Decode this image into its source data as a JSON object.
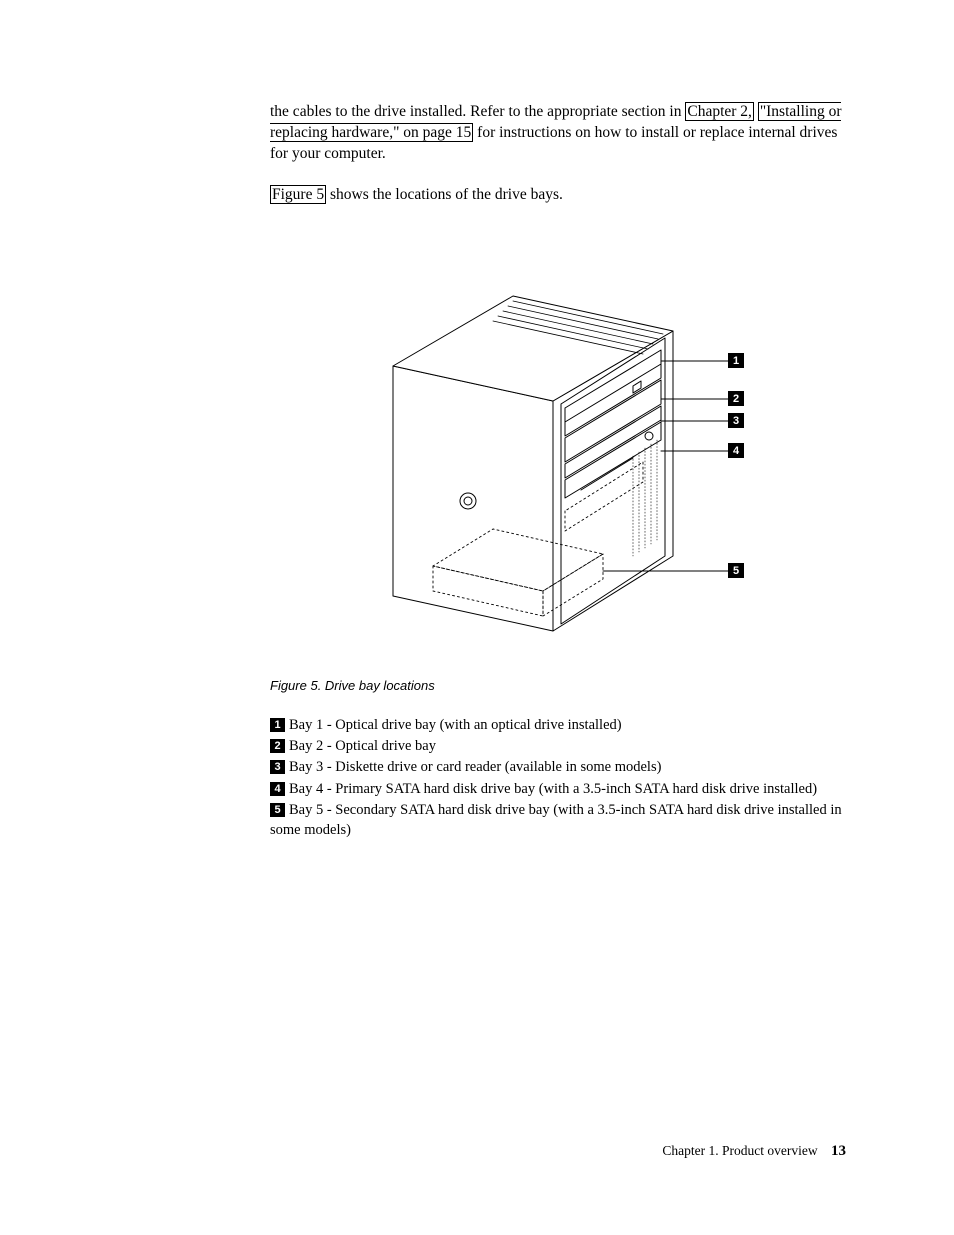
{
  "intro": {
    "t1a": "the cables to the drive installed. Refer to the appropriate section in ",
    "link1": "Chapter 2,",
    "link2": "\"Installing or replacing hardware,\" on page 15",
    "t1b": " for instructions on how to install or replace internal drives for your computer."
  },
  "intro2": {
    "link": "Figure 5",
    "rest": " shows the locations of the drive bays."
  },
  "figure": {
    "callouts": {
      "c1": "1",
      "c2": "2",
      "c3": "3",
      "c4": "4",
      "c5": "5"
    },
    "caption": "Figure 5. Drive bay locations"
  },
  "legend": {
    "n1": "1",
    "t1": "Bay 1 - Optical drive bay (with an optical drive installed)",
    "n2": "2",
    "t2": "Bay 2 - Optical drive bay",
    "n3": "3",
    "t3": "Bay 3 - Diskette drive or card reader (available in some models)",
    "n4": "4",
    "t4": "Bay 4 - Primary SATA hard disk drive bay (with a 3.5-inch SATA hard disk drive installed)",
    "n5": "5",
    "t5": "Bay 5 - Secondary SATA hard disk drive bay (with a 3.5-inch SATA hard disk drive installed in some models)"
  },
  "footer": {
    "chapter": "Chapter 1. Product overview",
    "page": "13"
  }
}
